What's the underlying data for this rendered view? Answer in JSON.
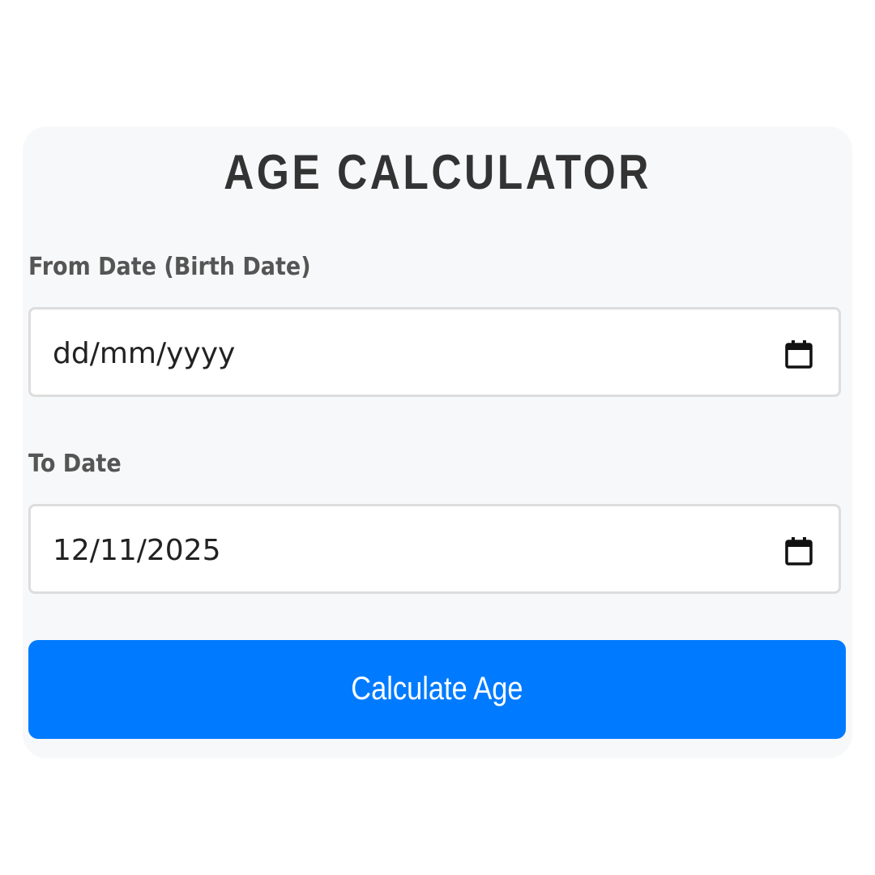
{
  "app": {
    "title": "AGE CALCULATOR"
  },
  "form": {
    "from_label": "From Date (Birth Date)",
    "from_value": "dd/mm/yyyy",
    "to_label": "To Date",
    "to_value": "12/11/2025",
    "submit_label": "Calculate Age"
  },
  "icons": {
    "date_picker": "calendar-icon"
  },
  "colors": {
    "accent": "#007bff",
    "card_bg": "#f7f8f9",
    "title": "#333333",
    "label": "#555555",
    "field_border": "#dddddd"
  }
}
